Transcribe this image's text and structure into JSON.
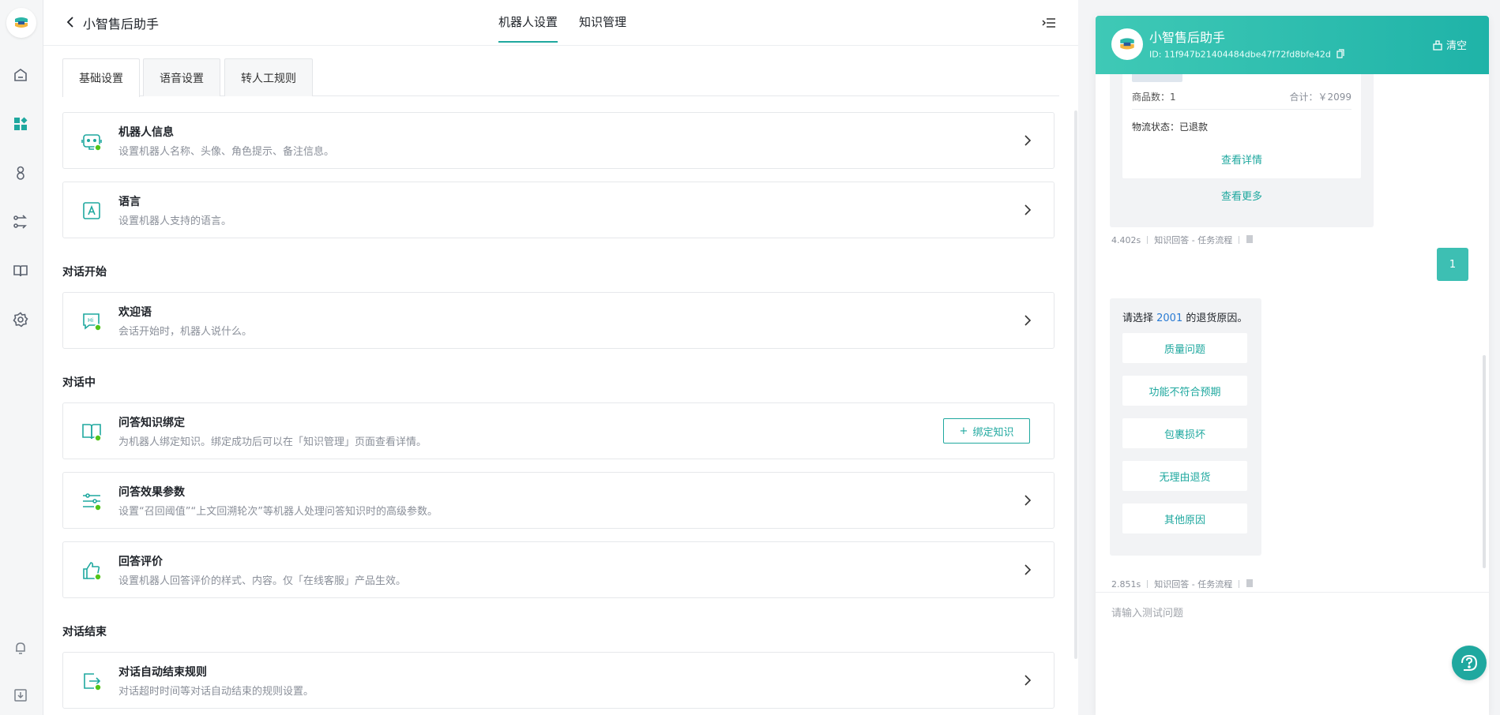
{
  "rail": {
    "icons": [
      "app-logo",
      "home-icon",
      "apps-icon",
      "user-icon",
      "flow-icon",
      "book-icon",
      "gear-icon",
      "bell-icon",
      "download-icon"
    ]
  },
  "header": {
    "title": "小智售后助手",
    "tabs": [
      {
        "label": "机器人设置",
        "active": true
      },
      {
        "label": "知识管理",
        "active": false
      }
    ]
  },
  "subtabs": [
    {
      "label": "基础设置",
      "active": true
    },
    {
      "label": "语音设置",
      "active": false
    },
    {
      "label": "转人工规则",
      "active": false
    }
  ],
  "cards": {
    "robot_info": {
      "title": "机器人信息",
      "desc": "设置机器人名称、头像、角色提示、备注信息。"
    },
    "language": {
      "title": "语言",
      "desc": "设置机器人支持的语言。"
    },
    "welcome": {
      "title": "欢迎语",
      "desc": "会话开始时，机器人说什么。"
    },
    "qa_bind": {
      "title": "问答知识绑定",
      "desc": "为机器人绑定知识。绑定成功后可以在「知识管理」页面查看详情。",
      "button": "绑定知识"
    },
    "qa_params": {
      "title": "问答效果参数",
      "desc": "设置“召回阈值”“上文回溯轮次”等机器人处理问答知识时的高级参数。"
    },
    "feedback": {
      "title": "回答评价",
      "desc": "设置机器人回答评价的样式、内容。仅「在线客服」产品生效。"
    },
    "auto_end": {
      "title": "对话自动结束规则",
      "desc": "对话超时时间等对话自动结束的规则设置。"
    }
  },
  "sections": {
    "start": "对话开始",
    "during": "对话中",
    "end": "对话结束"
  },
  "chat": {
    "name": "小智售后助手",
    "id": "ID: 11f947b21404484dbe47f72fd8bfe42d",
    "clear": "清空",
    "order": {
      "count": "商品数：1",
      "total": "合计：￥2099",
      "logistics": "物流状态：已退款",
      "detail_link": "查看详情",
      "more_link": "查看更多"
    },
    "meta1": {
      "time": "4.402s",
      "source": "知识回答 - 任务流程"
    },
    "user_msg": "1",
    "reply": {
      "prefix": "请选择 ",
      "order_no": "2001",
      "suffix": " 的退货原因。"
    },
    "options": [
      "质量问题",
      "功能不符合预期",
      "包裹损坏",
      "无理由退货",
      "其他原因"
    ],
    "meta2": {
      "time": "2.851s",
      "source": "知识回答 - 任务流程"
    },
    "input_placeholder": "请输入测试问题"
  },
  "colors": {
    "accent": "#1fa89f",
    "header_gradient_start": "#3fc9b6"
  }
}
